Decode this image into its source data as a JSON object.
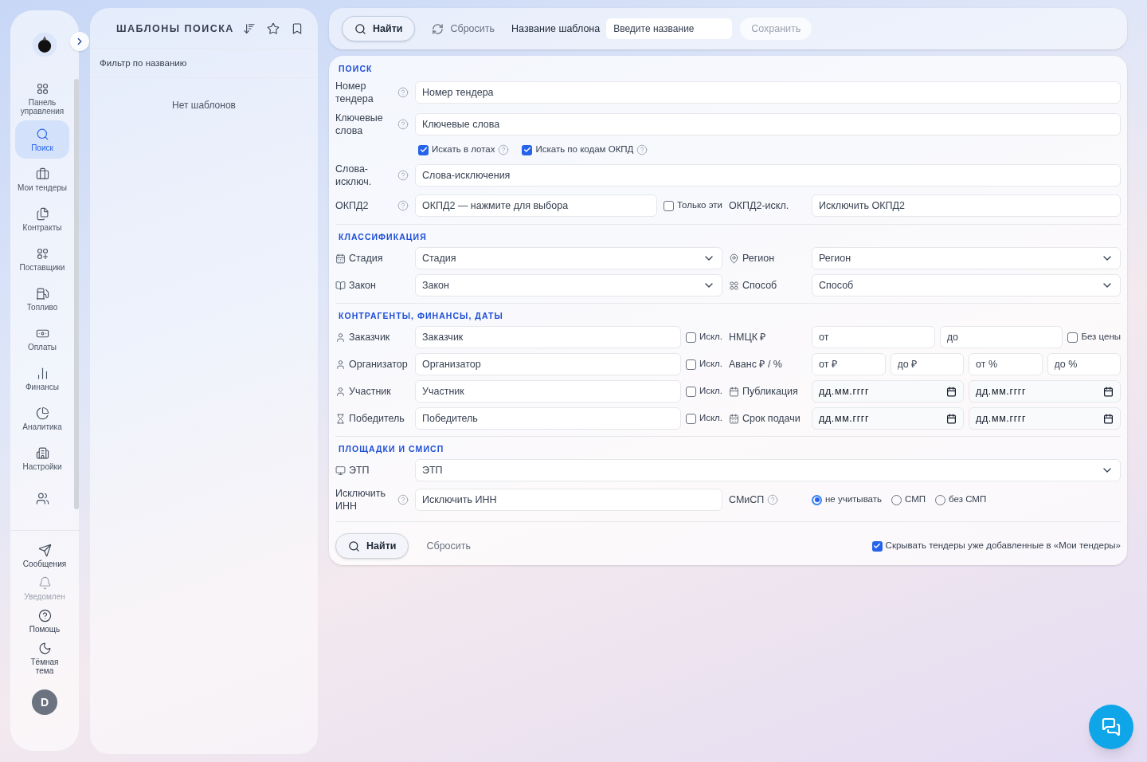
{
  "sidebar": {
    "nav": [
      {
        "label": "Панель управления",
        "selected": false
      },
      {
        "label": "Поиск",
        "selected": true
      },
      {
        "label": "Мои тендеры",
        "selected": false
      },
      {
        "label": "Контракты",
        "selected": false
      },
      {
        "label": "Поставщики",
        "selected": false
      },
      {
        "label": "Топливо",
        "selected": false
      },
      {
        "label": "Оплаты",
        "selected": false
      },
      {
        "label": "Финансы",
        "selected": false
      },
      {
        "label": "Аналитика",
        "selected": false
      },
      {
        "label": "Настройки",
        "selected": false
      },
      {
        "selected": false
      }
    ],
    "bottom": [
      {
        "label": "Сообщения",
        "disabled": false
      },
      {
        "label": "Уведомлен",
        "disabled": true
      },
      {
        "label": "Помощь",
        "disabled": false
      },
      {
        "label": "Тёмная тема",
        "disabled": false
      }
    ],
    "avatar": "D"
  },
  "templates": {
    "title": "ШАБЛОНЫ ПОИСКА",
    "filter_placeholder": "Фильтр по названию",
    "empty": "Нет шаблонов"
  },
  "toolbar": {
    "find": "Найти",
    "reset": "Сбросить",
    "name_label": "Название шаблона",
    "name_placeholder": "Введите название",
    "save": {
      "label": "Сохранить",
      "disabled": true
    }
  },
  "sections": [
    {
      "title": "ПОИСК",
      "rows": [
        {
          "kind": "text",
          "label": "Номер тендера",
          "help": true,
          "placeholder": "Номер тендера"
        },
        {
          "kind": "text",
          "label": "Ключевые слова",
          "help": true,
          "placeholder": "Ключевые слова"
        },
        {
          "kind": "checks",
          "items": [
            {
              "label": "Искать в лотах",
              "checked": true,
              "help": true
            },
            {
              "label": "Искать по кодам ОКПД",
              "checked": true,
              "help": true
            }
          ]
        },
        {
          "kind": "text",
          "label": "Слова-исключ.",
          "help": true,
          "placeholder": "Слова-исключения"
        },
        {
          "kind": "split",
          "label": "ОКПД2",
          "help": true,
          "placeholder": "ОКПД2 — нажмите для выбора",
          "check": {
            "label": "Только эти",
            "checked": false
          },
          "label2": "ОКПД2-искл.",
          "placeholder2": "Исключить ОКПД2"
        }
      ]
    },
    {
      "title": "КЛАССИФИКАЦИЯ",
      "rows": [
        {
          "kind": "selects",
          "label": "Стадия",
          "placeholder": "Стадия",
          "label2": "Регион",
          "placeholder2": "Регион"
        },
        {
          "kind": "selects",
          "label": "Закон",
          "placeholder": "Закон",
          "label2": "Способ",
          "placeholder2": "Способ"
        }
      ]
    },
    {
      "title": "КОНТРАГЕНТЫ, ФИНАНСЫ, ДАТЫ",
      "rows": [
        {
          "kind": "party",
          "label": "Заказчик",
          "placeholder": "Заказчик",
          "check": {
            "label": "Искл.",
            "checked": false
          },
          "label2": "НМЦК ₽",
          "inputs": [
            {
              "kind": "text",
              "placeholder": "от"
            },
            {
              "kind": "text",
              "placeholder": "до"
            }
          ],
          "extra": {
            "label": "Без цены",
            "checked": false
          }
        },
        {
          "kind": "party",
          "label": "Организатор",
          "placeholder": "Организатор",
          "check": {
            "label": "Искл.",
            "checked": false
          },
          "label2": "Аванс ₽ / %",
          "inputs": [
            {
              "kind": "text",
              "placeholder": "от ₽"
            },
            {
              "kind": "text",
              "placeholder": "до ₽"
            },
            {
              "kind": "text",
              "placeholder": "от %"
            },
            {
              "kind": "text",
              "placeholder": "до %"
            }
          ]
        },
        {
          "kind": "party",
          "label": "Участник",
          "placeholder": "Участник",
          "check": {
            "label": "Искл.",
            "checked": false
          },
          "label2": "Публикация",
          "inputs": [
            {
              "kind": "date",
              "placeholder": "дд.мм.гггг"
            },
            {
              "kind": "date",
              "placeholder": "дд.мм.гггг"
            }
          ]
        },
        {
          "kind": "party",
          "label": "Победитель",
          "placeholder": "Победитель",
          "check": {
            "label": "Искл.",
            "checked": false
          },
          "label2": "Срок подачи",
          "inputs": [
            {
              "kind": "date",
              "placeholder": "дд.мм.гггг"
            },
            {
              "kind": "date",
              "placeholder": "дд.мм.гггг"
            }
          ]
        }
      ]
    },
    {
      "title": "ПЛОЩАДКИ И СМИСП",
      "rows": [
        {
          "kind": "select",
          "label": "ЭТП",
          "placeholder": "ЭТП"
        },
        {
          "kind": "inn",
          "label": "Исключить ИНН",
          "help": true,
          "placeholder": "Исключить ИНН",
          "label2": "СМиСП",
          "help2": true,
          "radios": [
            {
              "label": "не учитывать",
              "selected": true
            },
            {
              "label": "СМП",
              "selected": false
            },
            {
              "label": "без СМП",
              "selected": false
            }
          ]
        }
      ]
    }
  ],
  "footer": {
    "find": "Найти",
    "reset": "Сбросить",
    "hide": {
      "label": "Скрывать тендеры уже добавленные в «Мои тендеры»",
      "checked": true
    }
  }
}
